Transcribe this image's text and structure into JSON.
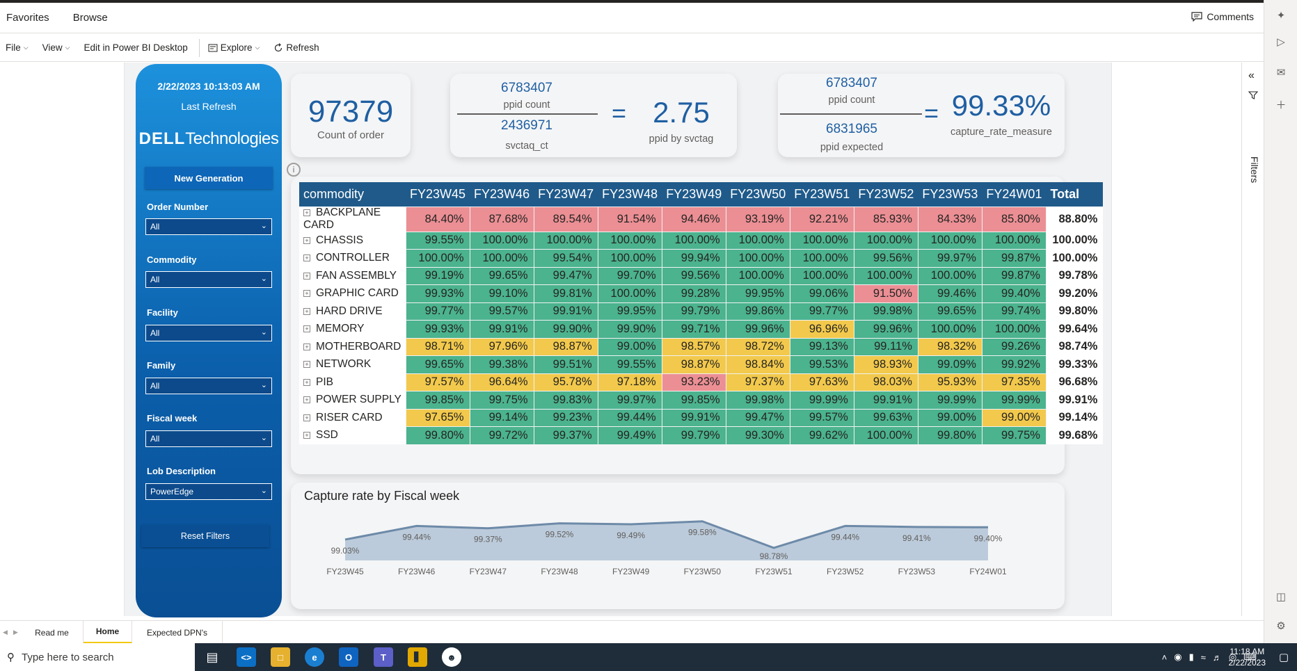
{
  "nav": {
    "favorites": "Favorites",
    "browse": "Browse",
    "comments": "Comments"
  },
  "toolbar": {
    "file": "File",
    "view": "View",
    "edit_desktop": "Edit in Power BI Desktop",
    "explore": "Explore",
    "refresh": "Refresh"
  },
  "filters_pane": {
    "label": "Filters"
  },
  "sidebar": {
    "refresh_time": "2/22/2023 10:13:03 AM",
    "refresh_label": "Last Refresh",
    "logo_brand": "DELL",
    "logo_suffix": "Technologies",
    "new_generation": "New Generation",
    "slicers": [
      {
        "label": "Order Number",
        "value": "All"
      },
      {
        "label": "Commodity",
        "value": "All"
      },
      {
        "label": "Facility",
        "value": "All"
      },
      {
        "label": "Family",
        "value": "All"
      },
      {
        "label": "Fiscal week",
        "value": "All"
      },
      {
        "label": "Lob Description",
        "value": "PowerEdge"
      }
    ],
    "reset_filters": "Reset Filters"
  },
  "kpi_orders": {
    "value": "97379",
    "label": "Count of order"
  },
  "kpi_ppid": {
    "numerator": "6783407",
    "numerator_label": "ppid count",
    "denominator": "2436971",
    "denominator_label": "svctaq_ct",
    "equals": "=",
    "result": "2.75",
    "result_label": "ppid by svctag"
  },
  "kpi_capture": {
    "numerator": "6783407",
    "numerator_label": "ppid count",
    "denominator": "6831965",
    "denominator_label": "ppid expected",
    "equals": "=",
    "result": "99.33%",
    "result_label": "capture_rate_measure"
  },
  "matrix": {
    "row_header": "commodity",
    "columns": [
      "FY23W45",
      "FY23W46",
      "FY23W47",
      "FY23W48",
      "FY23W49",
      "FY23W50",
      "FY23W51",
      "FY23W52",
      "FY23W53",
      "FY24W01"
    ],
    "total_header": "Total",
    "rows": [
      {
        "name": "BACKPLANE CARD",
        "values": [
          "84.40%",
          "87.68%",
          "89.54%",
          "91.54%",
          "94.46%",
          "93.19%",
          "92.21%",
          "85.93%",
          "84.33%",
          "85.80%"
        ],
        "colors": [
          "r",
          "r",
          "r",
          "r",
          "r",
          "r",
          "r",
          "r",
          "r",
          "r"
        ],
        "total": "88.80%"
      },
      {
        "name": "CHASSIS",
        "values": [
          "99.55%",
          "100.00%",
          "100.00%",
          "100.00%",
          "100.00%",
          "100.00%",
          "100.00%",
          "100.00%",
          "100.00%",
          "100.00%"
        ],
        "colors": [
          "g",
          "g",
          "g",
          "g",
          "g",
          "g",
          "g",
          "g",
          "g",
          "g"
        ],
        "total": "100.00%"
      },
      {
        "name": "CONTROLLER",
        "values": [
          "100.00%",
          "100.00%",
          "99.54%",
          "100.00%",
          "99.94%",
          "100.00%",
          "100.00%",
          "99.56%",
          "99.97%",
          "99.87%"
        ],
        "colors": [
          "g",
          "g",
          "g",
          "g",
          "g",
          "g",
          "g",
          "g",
          "g",
          "g"
        ],
        "total": "100.00%"
      },
      {
        "name": "FAN ASSEMBLY",
        "values": [
          "99.19%",
          "99.65%",
          "99.47%",
          "99.70%",
          "99.56%",
          "100.00%",
          "100.00%",
          "100.00%",
          "100.00%",
          "99.87%"
        ],
        "colors": [
          "g",
          "g",
          "g",
          "g",
          "g",
          "g",
          "g",
          "g",
          "g",
          "g"
        ],
        "total": "99.78%"
      },
      {
        "name": "GRAPHIC CARD",
        "values": [
          "99.93%",
          "99.10%",
          "99.81%",
          "100.00%",
          "99.28%",
          "99.95%",
          "99.06%",
          "91.50%",
          "99.46%",
          "99.40%"
        ],
        "colors": [
          "g",
          "g",
          "g",
          "g",
          "g",
          "g",
          "g",
          "r",
          "g",
          "g"
        ],
        "total": "99.20%"
      },
      {
        "name": "HARD DRIVE",
        "values": [
          "99.77%",
          "99.57%",
          "99.91%",
          "99.95%",
          "99.79%",
          "99.86%",
          "99.77%",
          "99.98%",
          "99.65%",
          "99.74%"
        ],
        "colors": [
          "g",
          "g",
          "g",
          "g",
          "g",
          "g",
          "g",
          "g",
          "g",
          "g"
        ],
        "total": "99.80%"
      },
      {
        "name": "MEMORY",
        "values": [
          "99.93%",
          "99.91%",
          "99.90%",
          "99.90%",
          "99.71%",
          "99.96%",
          "96.96%",
          "99.96%",
          "100.00%",
          "100.00%"
        ],
        "colors": [
          "g",
          "g",
          "g",
          "g",
          "g",
          "g",
          "y",
          "g",
          "g",
          "g"
        ],
        "total": "99.64%"
      },
      {
        "name": "MOTHERBOARD",
        "values": [
          "98.71%",
          "97.96%",
          "98.87%",
          "99.00%",
          "98.57%",
          "98.72%",
          "99.13%",
          "99.11%",
          "98.32%",
          "99.26%"
        ],
        "colors": [
          "y",
          "y",
          "y",
          "g",
          "y",
          "y",
          "g",
          "g",
          "y",
          "g"
        ],
        "total": "98.74%"
      },
      {
        "name": "NETWORK",
        "values": [
          "99.65%",
          "99.38%",
          "99.51%",
          "99.55%",
          "98.87%",
          "98.84%",
          "99.53%",
          "98.93%",
          "99.09%",
          "99.92%"
        ],
        "colors": [
          "g",
          "g",
          "g",
          "g",
          "y",
          "y",
          "g",
          "y",
          "g",
          "g"
        ],
        "total": "99.33%"
      },
      {
        "name": "PIB",
        "values": [
          "97.57%",
          "96.64%",
          "95.78%",
          "97.18%",
          "93.23%",
          "97.37%",
          "97.63%",
          "98.03%",
          "95.93%",
          "97.35%"
        ],
        "colors": [
          "y",
          "y",
          "y",
          "y",
          "r",
          "y",
          "y",
          "y",
          "y",
          "y"
        ],
        "total": "96.68%"
      },
      {
        "name": "POWER SUPPLY",
        "values": [
          "99.85%",
          "99.75%",
          "99.83%",
          "99.97%",
          "99.85%",
          "99.98%",
          "99.99%",
          "99.91%",
          "99.99%",
          "99.99%"
        ],
        "colors": [
          "g",
          "g",
          "g",
          "g",
          "g",
          "g",
          "g",
          "g",
          "g",
          "g"
        ],
        "total": "99.91%"
      },
      {
        "name": "RISER CARD",
        "values": [
          "97.65%",
          "99.14%",
          "99.23%",
          "99.44%",
          "99.91%",
          "99.47%",
          "99.57%",
          "99.63%",
          "99.00%",
          "99.00%"
        ],
        "colors": [
          "y",
          "g",
          "g",
          "g",
          "g",
          "g",
          "g",
          "g",
          "g",
          "y"
        ],
        "total": "99.14%"
      },
      {
        "name": "SSD",
        "values": [
          "99.80%",
          "99.72%",
          "99.37%",
          "99.49%",
          "99.79%",
          "99.30%",
          "99.62%",
          "100.00%",
          "99.80%",
          "99.75%"
        ],
        "colors": [
          "g",
          "g",
          "g",
          "g",
          "g",
          "g",
          "g",
          "g",
          "g",
          "g"
        ],
        "total": "99.68%"
      }
    ]
  },
  "chart_data": {
    "type": "area",
    "title": "Capture rate by Fiscal week",
    "categories": [
      "FY23W45",
      "FY23W46",
      "FY23W47",
      "FY23W48",
      "FY23W49",
      "FY23W50",
      "FY23W51",
      "FY23W52",
      "FY23W53",
      "FY24W01"
    ],
    "values": [
      99.03,
      99.44,
      99.37,
      99.52,
      99.49,
      99.58,
      98.78,
      99.44,
      99.41,
      99.4
    ],
    "labels": [
      "99.03%",
      "99.44%",
      "99.37%",
      "99.52%",
      "99.49%",
      "99.58%",
      "98.78%",
      "99.44%",
      "99.41%",
      "99.40%"
    ],
    "xlabel": "",
    "ylabel": "",
    "ylim": [
      98.4,
      99.7
    ],
    "grid": false,
    "colors": {
      "line": "#6d8aa8",
      "fill": "#bccbdb"
    }
  },
  "pagetabs": [
    "Read me",
    "Home",
    "Expected DPN's"
  ],
  "taskbar": {
    "search_placeholder": "Type here to search",
    "time": "11:18 AM",
    "date": "2/22/2023"
  },
  "colors": {
    "green": "#4bb38e",
    "yellow": "#f2c94c",
    "red": "#eb8f94",
    "header": "#1f5a8a",
    "accent": "#1f5fa2"
  }
}
